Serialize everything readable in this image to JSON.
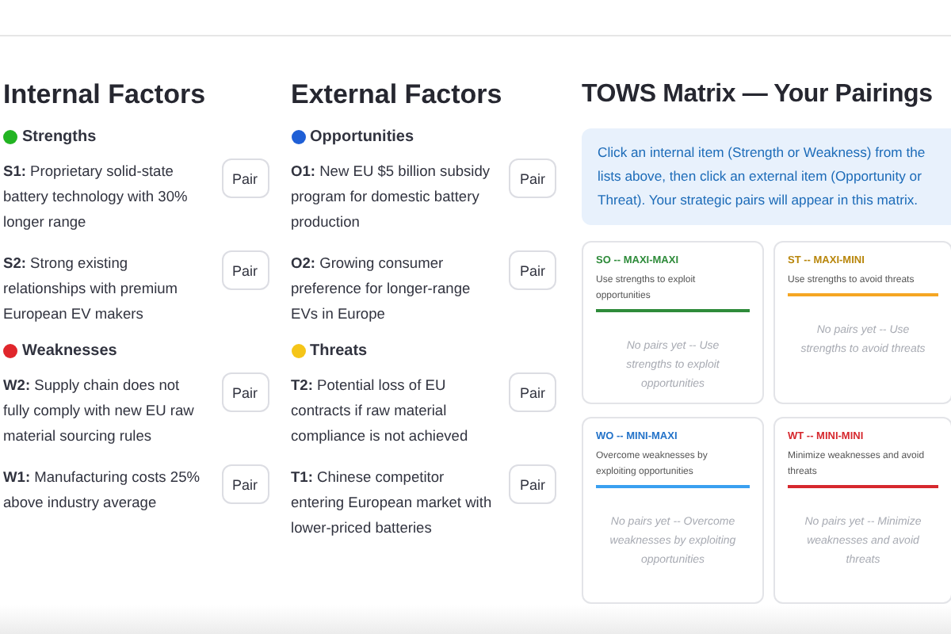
{
  "internal": {
    "title": "Internal Factors",
    "groups": [
      {
        "label": "Strengths",
        "color": "#22b422",
        "items": [
          {
            "text": "**S1:** Proprietary solid-state battery technology with 30% longer range",
            "button": "Pair"
          },
          {
            "text": "**S2:** Strong existing relationships with premium European EV makers",
            "button": "Pair"
          }
        ]
      },
      {
        "label": "Weaknesses",
        "color": "#e0262b",
        "items": [
          {
            "text": "**W2:** Supply chain does not fully comply with new EU raw material sourcing rules",
            "button": "Pair"
          },
          {
            "text": "**W1:** Manufacturing costs 25% above industry average",
            "button": "Pair"
          }
        ]
      }
    ]
  },
  "external": {
    "title": "External Factors",
    "groups": [
      {
        "label": "Opportunities",
        "color": "#1f5fd6",
        "items": [
          {
            "text": "**O1:** New EU $5 billion subsidy program for domestic battery production",
            "button": "Pair"
          },
          {
            "text": "**O2:** Growing consumer preference for longer-range EVs in Europe",
            "button": "Pair"
          }
        ]
      },
      {
        "label": "Threats",
        "color": "#f5c518",
        "items": [
          {
            "text": "**T2:** Potential loss of EU contracts if raw material compliance is not achieved",
            "button": "Pair"
          },
          {
            "text": "**T1:** Chinese competitor entering European market with lower-priced batteries",
            "button": "Pair"
          }
        ]
      }
    ]
  },
  "matrix": {
    "title": "TOWS Matrix — Your Pairings",
    "info": "Click an internal item (Strength or Weakness) from the lists above, then click an external item (Opportunity or Threat). Your strategic pairs will appear in this matrix.",
    "quadrants": [
      {
        "title": "SO -- MAXI-MAXI",
        "color": "#2e8b3a",
        "description": "Use strengths to exploit opportunities",
        "empty": "No pairs yet -- Use strengths to exploit opportunities"
      },
      {
        "title": "ST -- MAXI-MINI",
        "color": "#b8860b",
        "description": "Use strengths to avoid threats",
        "empty": "No pairs yet -- Use strengths to avoid threats"
      },
      {
        "title": "WO -- MINI-MAXI",
        "color": "#2473c9",
        "description": "Overcome weaknesses by exploiting opportunities",
        "empty": "No pairs yet -- Overcome weaknesses by exploiting opportunities"
      },
      {
        "title": "WT -- MINI-MINI",
        "color": "#d6282e",
        "description": "Minimize weaknesses and avoid threats",
        "empty": "No pairs yet -- Minimize weaknesses and avoid threats"
      }
    ]
  }
}
